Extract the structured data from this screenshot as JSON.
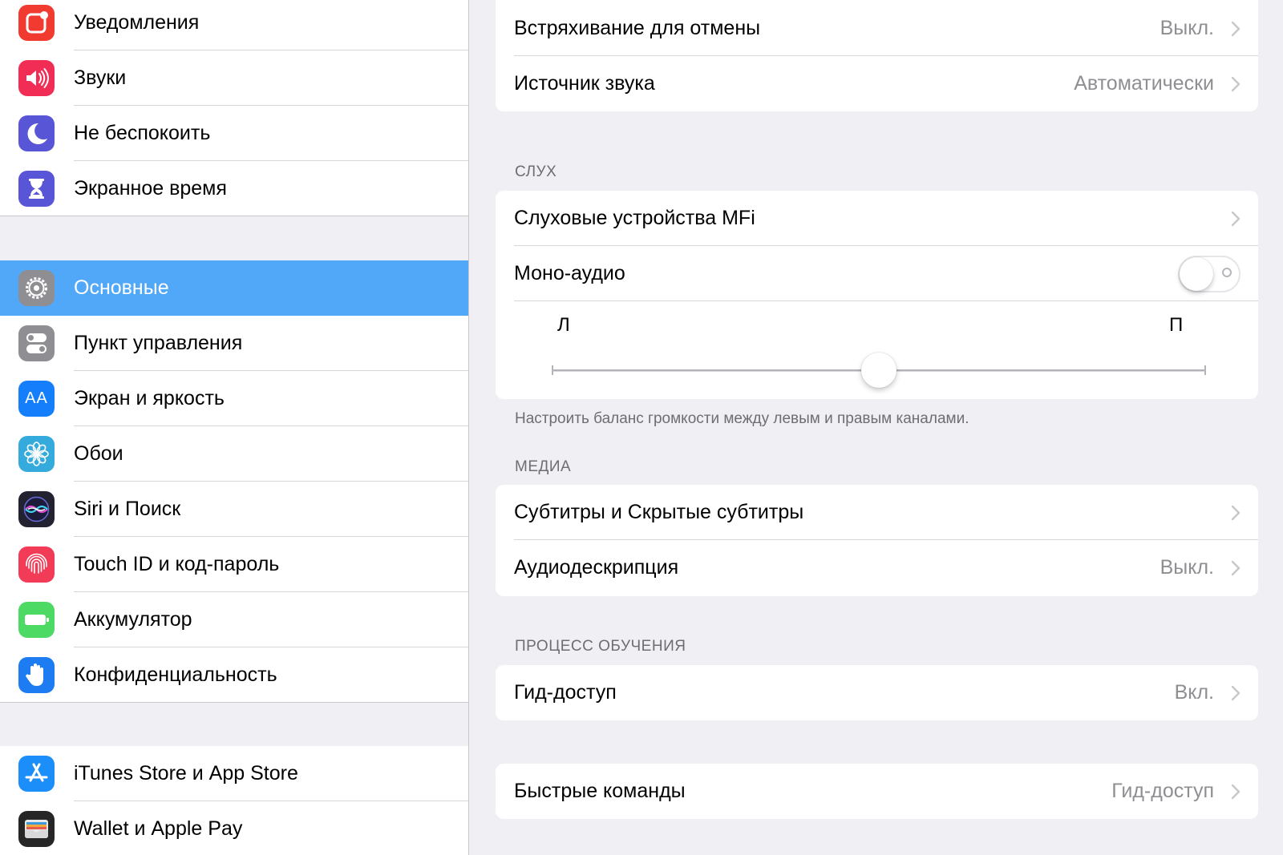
{
  "sidebar": {
    "group1": [
      {
        "label": "Уведомления",
        "icon": "notifications-icon",
        "color": "#f23b30"
      },
      {
        "label": "Звуки",
        "icon": "sounds-icon",
        "color": "#f12d55"
      },
      {
        "label": "Не беспокоить",
        "icon": "moon-icon",
        "color": "#5856d6"
      },
      {
        "label": "Экранное время",
        "icon": "hourglass-icon",
        "color": "#5856d6"
      }
    ],
    "group2": [
      {
        "label": "Основные",
        "icon": "gear-icon",
        "color": "#8e8e93",
        "selected": true
      },
      {
        "label": "Пункт управления",
        "icon": "control-center-icon",
        "color": "#8e8e93"
      },
      {
        "label": "Экран и яркость",
        "icon": "display-icon",
        "color": "#157efb",
        "glyph": "AA"
      },
      {
        "label": "Обои",
        "icon": "wallpaper-flower-icon",
        "color": "#35aadc"
      },
      {
        "label": "Siri и Поиск",
        "icon": "siri-icon",
        "color": "#222230"
      },
      {
        "label": "Touch ID и код-пароль",
        "icon": "fingerprint-icon",
        "color": "#f23b56"
      },
      {
        "label": "Аккумулятор",
        "icon": "battery-icon",
        "color": "#4cd964"
      },
      {
        "label": "Конфиденциальность",
        "icon": "hand-icon",
        "color": "#1e7cf2"
      }
    ],
    "group3": [
      {
        "label": "iTunes Store и App Store",
        "icon": "app-store-icon",
        "color": "#1c8ef9"
      },
      {
        "label": "Wallet и Apple Pay",
        "icon": "wallet-icon",
        "color": "#262626"
      }
    ]
  },
  "detail": {
    "top_rows": [
      {
        "label": "Встряхивание для отмены",
        "value": "Выкл."
      },
      {
        "label": "Источник звука",
        "value": "Автоматически"
      }
    ],
    "hearing": {
      "header": "СЛУХ",
      "mfi_label": "Слуховые устройства MFi",
      "mono_label": "Моно-аудио",
      "mono_on": false,
      "balance_left": "Л",
      "balance_right": "П",
      "balance_value": 0.5,
      "footer": "Настроить баланс громкости между левым и правым каналами."
    },
    "media": {
      "header": "МЕДИА",
      "rows": [
        {
          "label": "Субтитры и Скрытые субтитры",
          "value": ""
        },
        {
          "label": "Аудиодескрипция",
          "value": "Выкл."
        }
      ]
    },
    "learning": {
      "header": "ПРОЦЕСС ОБУЧЕНИЯ",
      "row": {
        "label": "Гид-доступ",
        "value": "Вкл."
      }
    },
    "shortcut": {
      "label": "Быстрые команды",
      "value": "Гид-доступ"
    }
  },
  "colors": {
    "selection": "#52a8f8",
    "background": "#efeff4",
    "secondary_text": "#8e8e93",
    "chevron": "#c7c7cc"
  }
}
